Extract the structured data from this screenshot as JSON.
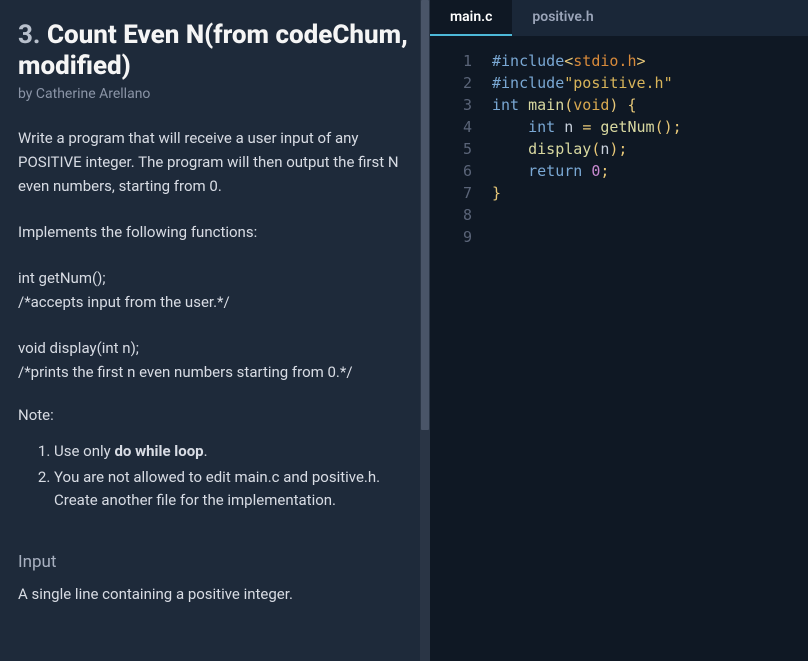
{
  "problem": {
    "number": "3.",
    "title": "Count Even N(from codeChum, modified)",
    "author": "by Catherine Arellano",
    "description": "Write a program that will receive a user input of any POSITIVE integer. The program will then output the first N even numbers, starting from 0.",
    "implements": "Implements the following functions:",
    "func1_sig": "int getNum();",
    "func1_comment": "/*accepts input from the user.*/",
    "func2_sig": "void display(int n);",
    "func2_comment": "/*prints the first n even numbers starting from 0.*/",
    "note_label": "Note:",
    "notes": [
      {
        "pre": "Use only ",
        "bold": "do while loop",
        "post": "."
      },
      {
        "pre": "You are not allowed to edit main.c and positive.h. Create another file for the implementation.",
        "bold": "",
        "post": ""
      }
    ],
    "input_heading": "Input",
    "input_desc": "A single line containing a positive integer."
  },
  "tabs": [
    {
      "label": "main.c",
      "active": true
    },
    {
      "label": "positive.h",
      "active": false
    }
  ],
  "code": {
    "line_count": 9,
    "lines": [
      [
        {
          "t": "#include",
          "c": "tok-pp"
        },
        {
          "t": "<",
          "c": "tok-punc"
        },
        {
          "t": "stdio.h",
          "c": "tok-hdr"
        },
        {
          "t": ">",
          "c": "tok-punc"
        }
      ],
      [
        {
          "t": "#include",
          "c": "tok-pp"
        },
        {
          "t": "\"positive.h\"",
          "c": "tok-str"
        }
      ],
      [
        {
          "t": "int ",
          "c": "tok-kw"
        },
        {
          "t": "main",
          "c": "tok-fn"
        },
        {
          "t": "(",
          "c": "tok-punc"
        },
        {
          "t": "void",
          "c": "tok-type"
        },
        {
          "t": ") {",
          "c": "tok-punc"
        }
      ],
      [
        {
          "t": "    ",
          "c": ""
        },
        {
          "t": "int ",
          "c": "tok-kw"
        },
        {
          "t": "n ",
          "c": "tok-id"
        },
        {
          "t": "= ",
          "c": "tok-punc"
        },
        {
          "t": "getNum",
          "c": "tok-fn"
        },
        {
          "t": "();",
          "c": "tok-punc"
        }
      ],
      [
        {
          "t": "    ",
          "c": ""
        },
        {
          "t": "display",
          "c": "tok-fn"
        },
        {
          "t": "(",
          "c": "tok-punc"
        },
        {
          "t": "n",
          "c": "tok-id"
        },
        {
          "t": ");",
          "c": "tok-punc"
        }
      ],
      [
        {
          "t": "    ",
          "c": ""
        },
        {
          "t": "return ",
          "c": "tok-kw"
        },
        {
          "t": "0",
          "c": "tok-num"
        },
        {
          "t": ";",
          "c": "tok-punc"
        }
      ],
      [
        {
          "t": "}",
          "c": "tok-punc"
        }
      ],
      [],
      []
    ]
  }
}
